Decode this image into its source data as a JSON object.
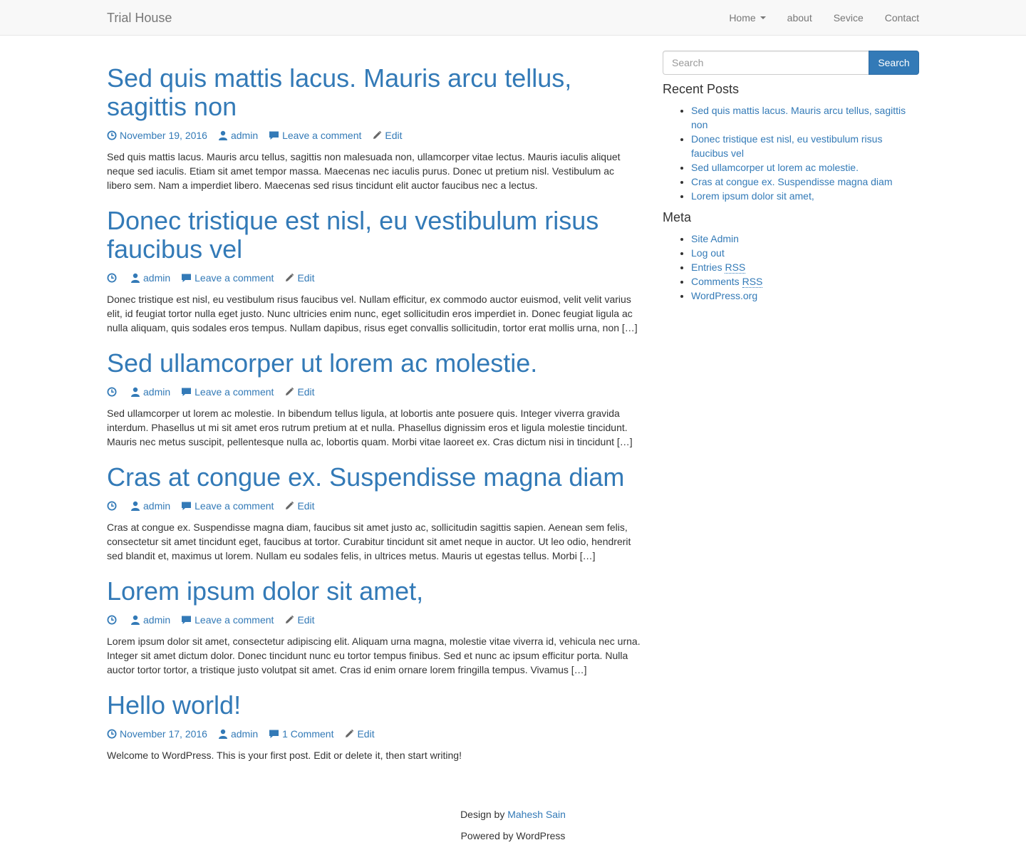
{
  "site": {
    "brand": "Trial House"
  },
  "nav": {
    "home": "Home",
    "about": "about",
    "service": "Sevice",
    "contact": "Contact"
  },
  "posts": [
    {
      "title": "Sed quis mattis lacus. Mauris arcu tellus, sagittis non",
      "date": "November 19, 2016",
      "author": "admin",
      "comments": "Leave a comment",
      "edit": "Edit",
      "excerpt": "Sed quis mattis lacus. Mauris arcu tellus, sagittis non malesuada non, ullamcorper vitae lectus. Mauris iaculis aliquet neque sed iaculis. Etiam sit amet tempor massa. Maecenas nec iaculis purus. Donec ut pretium nisl. Vestibulum ac libero sem. Nam a imperdiet libero. Maecenas sed risus tincidunt elit auctor faucibus nec a lectus."
    },
    {
      "title": "Donec tristique est nisl, eu vestibulum risus faucibus vel",
      "date": "",
      "author": "admin",
      "comments": "Leave a comment",
      "edit": "Edit",
      "excerpt": "Donec tristique est nisl, eu vestibulum risus faucibus vel. Nullam efficitur, ex commodo auctor euismod, velit velit varius elit, id feugiat tortor nulla eget justo. Nunc ultricies enim nunc, eget sollicitudin eros imperdiet in. Donec feugiat ligula ac nulla aliquam, quis sodales eros tempus. Nullam dapibus, risus eget convallis sollicitudin, tortor erat mollis urna, non […]"
    },
    {
      "title": "Sed ullamcorper ut lorem ac molestie.",
      "date": "",
      "author": "admin",
      "comments": "Leave a comment",
      "edit": "Edit",
      "excerpt": "Sed ullamcorper ut lorem ac molestie. In bibendum tellus ligula, at lobortis ante posuere quis. Integer viverra gravida interdum. Phasellus ut mi sit amet eros rutrum pretium at et nulla. Phasellus dignissim eros et ligula molestie tincidunt. Mauris nec metus suscipit, pellentesque nulla ac, lobortis quam. Morbi vitae laoreet ex. Cras dictum nisi in tincidunt […]"
    },
    {
      "title": "Cras at congue ex. Suspendisse magna diam",
      "date": "",
      "author": "admin",
      "comments": "Leave a comment",
      "edit": "Edit",
      "excerpt": "Cras at congue ex. Suspendisse magna diam, faucibus sit amet justo ac, sollicitudin sagittis sapien. Aenean sem felis, consectetur sit amet tincidunt eget, faucibus at tortor. Curabitur tincidunt sit amet neque in auctor. Ut leo odio, hendrerit sed blandit et, maximus ut lorem. Nullam eu sodales felis, in ultrices metus. Mauris ut egestas tellus. Morbi […]"
    },
    {
      "title": "Lorem ipsum dolor sit amet,",
      "date": "",
      "author": "admin",
      "comments": "Leave a comment",
      "edit": "Edit",
      "excerpt": "Lorem ipsum dolor sit amet, consectetur adipiscing elit. Aliquam urna magna, molestie vitae viverra id, vehicula nec urna. Integer sit amet dictum dolor. Donec tincidunt nunc eu tortor tempus finibus. Sed et nunc ac ipsum efficitur porta. Nulla auctor tortor tortor, a tristique justo volutpat sit amet. Cras id enim ornare lorem fringilla tempus. Vivamus […]"
    },
    {
      "title": "Hello world!",
      "date": "November 17, 2016",
      "author": "admin",
      "comments": "1 Comment",
      "edit": "Edit",
      "excerpt": "Welcome to WordPress. This is your first post. Edit or delete it, then start writing!"
    }
  ],
  "sidebar": {
    "search": {
      "placeholder": "Search",
      "button": "Search"
    },
    "recent_title": "Recent Posts",
    "recent": [
      "Sed quis mattis lacus. Mauris arcu tellus, sagittis non",
      "Donec tristique est nisl, eu vestibulum risus faucibus vel",
      "Sed ullamcorper ut lorem ac molestie.",
      "Cras at congue ex. Suspendisse magna diam",
      "Lorem ipsum dolor sit amet,"
    ],
    "meta_title": "Meta",
    "meta": {
      "site_admin": "Site Admin",
      "log_out": "Log out",
      "entries_prefix": "Entries",
      "entries_rss": "RSS",
      "comments_prefix": "Comments",
      "comments_rss": "RSS",
      "wordpress": "WordPress.org"
    }
  },
  "footer": {
    "design_prefix": "Design by",
    "designer": "Mahesh Sain",
    "powered": "Powered by WordPress"
  },
  "colors": {
    "link": "#337ab7",
    "text": "#333333",
    "navbar_bg": "#f8f8f8",
    "nav_text": "#777777"
  }
}
